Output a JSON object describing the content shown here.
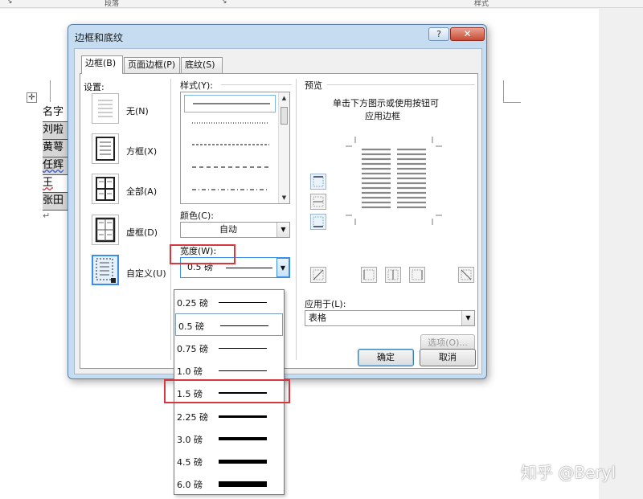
{
  "ribbon": {
    "group_paragraph": "段落",
    "group_styles": "样式"
  },
  "document": {
    "anchor_icon": "move-handle-icon",
    "cells": [
      "名字",
      "刘啦",
      "黄萼",
      "任辉",
      "王",
      "张田"
    ],
    "return_mark": "↵"
  },
  "dialog": {
    "title": "边框和底纹",
    "help": "?",
    "close": "✕",
    "tabs": [
      "边框(B)",
      "页面边框(P)",
      "底纹(S)"
    ],
    "settings_label": "设置:",
    "settings": [
      {
        "label": "无(N)",
        "icon": "border-none-icon"
      },
      {
        "label": "方框(X)",
        "icon": "border-box-icon"
      },
      {
        "label": "全部(A)",
        "icon": "border-all-icon"
      },
      {
        "label": "虚框(D)",
        "icon": "border-grid-icon"
      },
      {
        "label": "自定义(U)",
        "icon": "border-custom-icon"
      }
    ],
    "style_label": "样式(Y):",
    "style_lines": [
      "solid",
      "dotted",
      "dashed-fine",
      "dashed",
      "dash-dot"
    ],
    "color_label": "颜色(C):",
    "color_value": "自动",
    "width_label": "宽度(W):",
    "width_value": "0.5 磅",
    "preview_label": "预览",
    "preview_hint_line1": "单击下方图示或使用按钮可",
    "preview_hint_line2": "应用边框",
    "apply_to_label": "应用于(L):",
    "apply_to_value": "表格",
    "options_button": "选项(O)...",
    "ok_button": "确定",
    "cancel_button": "取消"
  },
  "width_dropdown": {
    "items": [
      {
        "label": "0.25 磅",
        "thickness": 0.25
      },
      {
        "label": "0.5 磅",
        "thickness": 0.5
      },
      {
        "label": "0.75 磅",
        "thickness": 0.75
      },
      {
        "label": "1.0 磅",
        "thickness": 1.0
      },
      {
        "label": "1.5 磅",
        "thickness": 1.5
      },
      {
        "label": "2.25 磅",
        "thickness": 2.25
      },
      {
        "label": "3.0 磅",
        "thickness": 3.0
      },
      {
        "label": "4.5 磅",
        "thickness": 4.5
      },
      {
        "label": "6.0 磅",
        "thickness": 6.0
      }
    ],
    "hover_index": 1,
    "highlight_index": 4
  },
  "colors": {
    "highlight_red": "#d9363e",
    "accent_blue": "#3a8ee6"
  },
  "watermark": "知乎 @Beryl"
}
